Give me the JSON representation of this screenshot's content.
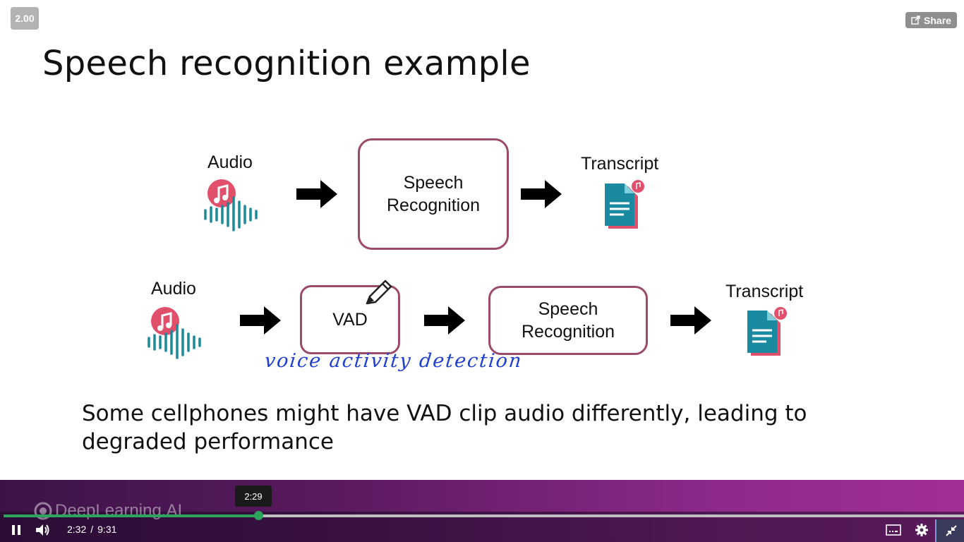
{
  "player": {
    "speed": "2.00",
    "share_label": "Share",
    "brand": "DeepLearning.AI",
    "seek_tooltip": "2:29",
    "current_time": "2:32",
    "time_separator": "/",
    "duration": "9:31",
    "progress_fraction": 0.266
  },
  "slide": {
    "title": "Speech recognition example",
    "row1": {
      "input_label": "Audio",
      "box_line1": "Speech",
      "box_line2": "Recognition",
      "output_label": "Transcript"
    },
    "row2": {
      "input_label": "Audio",
      "vad_label": "VAD",
      "box_line1": "Speech",
      "box_line2": "Recognition",
      "output_label": "Transcript",
      "handwritten_note": "voice activity detection"
    },
    "note": "Some cellphones might have VAD clip audio differently, leading to degraded performance"
  },
  "colors": {
    "box_border": "#9c4a6a",
    "audio_icon": "#e0506a",
    "waveform": "#1a8a9a",
    "doc_icon": "#1a8aa0",
    "handwriting": "#1f3fd0",
    "progress": "#2ea55c"
  },
  "icons": [
    "share-icon",
    "audio-icon",
    "transcript-icon",
    "pencil-icon",
    "pause-icon",
    "volume-icon",
    "captions-icon",
    "settings-icon",
    "exit-fullscreen-icon"
  ]
}
